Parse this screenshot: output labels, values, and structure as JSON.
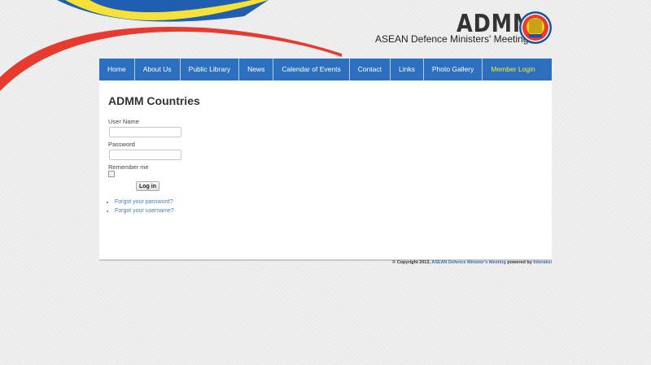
{
  "header": {
    "logo_title": "ADMM",
    "logo_subtitle": "ASEAN Defence Ministers' Meeting",
    "emblem_icon": "asean-emblem-icon"
  },
  "nav": {
    "items": [
      {
        "label": "Home"
      },
      {
        "label": "About Us"
      },
      {
        "label": "Public Library"
      },
      {
        "label": "News"
      },
      {
        "label": "Calendar of Events"
      },
      {
        "label": "Contact"
      },
      {
        "label": "Links"
      },
      {
        "label": "Photo Gallery"
      },
      {
        "label": "Member Login"
      }
    ]
  },
  "main": {
    "title": "ADMM Countries",
    "username_label": "User Name",
    "username_value": "",
    "password_label": "Password",
    "password_value": "",
    "remember_label": "Remember me",
    "login_button": "Log in",
    "forgot_password": "Forgot your password?",
    "forgot_username": "Forgot your username?"
  },
  "footer": {
    "copyright": "© Copyright 2013,",
    "site_link": "ASEAN Defence Minister's Meeting",
    "powered_by": "powered by",
    "vendor_link": "Interaksi"
  },
  "colors": {
    "nav_bg": "#2d6fbf",
    "nav_active": "#f3ee2e",
    "link": "#4a7ab0",
    "swoosh_blue": "#1f5eb0",
    "swoosh_yellow": "#f5e13a",
    "swoosh_red": "#e63b2e"
  }
}
